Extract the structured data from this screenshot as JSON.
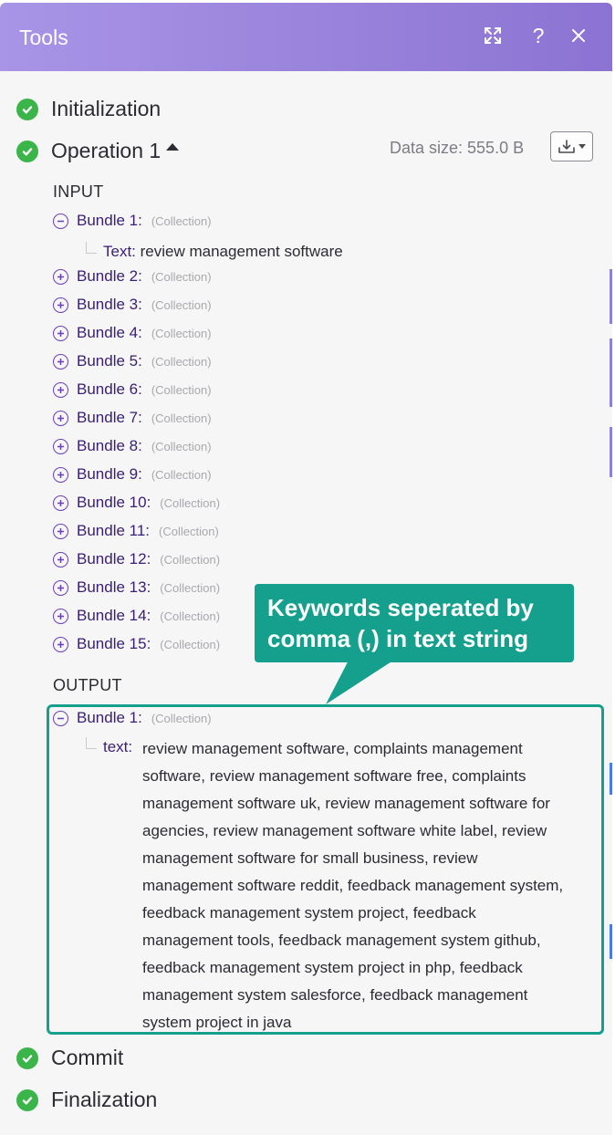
{
  "header": {
    "title": "Tools"
  },
  "steps": {
    "initialization": "Initialization",
    "operation": "Operation 1",
    "commit": "Commit",
    "finalization": "Finalization"
  },
  "data_size": "Data size: 555.0 B",
  "input": {
    "label": "INPUT",
    "bundles": [
      "Bundle 1:",
      "Bundle 2:",
      "Bundle 3:",
      "Bundle 4:",
      "Bundle 5:",
      "Bundle 6:",
      "Bundle 7:",
      "Bundle 8:",
      "Bundle 9:",
      "Bundle 10:",
      "Bundle 11:",
      "Bundle 12:",
      "Bundle 13:",
      "Bundle 14:",
      "Bundle 15:"
    ],
    "collection_tag": "(Collection)",
    "bundle1_key": "Text:",
    "bundle1_value": "review management software"
  },
  "output": {
    "label": "OUTPUT",
    "bundle": "Bundle 1:",
    "collection_tag": "(Collection)",
    "key": "text:",
    "lines": [
      "review management software, complaints management",
      "software, review management software free, complaints",
      "management software uk, review management software for",
      "agencies, review management software white label, review",
      "management software for small business, review",
      "management software reddit, feedback management system,",
      "feedback management system project, feedback",
      "management tools, feedback management system github,",
      "feedback management system project in php, feedback",
      "management system salesforce, feedback management",
      "system project in java"
    ]
  },
  "callout": {
    "line1": "Keywords seperated by",
    "line2": "comma (,) in text string"
  },
  "colors": {
    "header_start": "#a895e6",
    "header_end": "#8c73d3",
    "success": "#3bb54a",
    "bundle_key": "#3a1e73",
    "toggle": "#6b3fb8",
    "callout": "#14a08c"
  }
}
